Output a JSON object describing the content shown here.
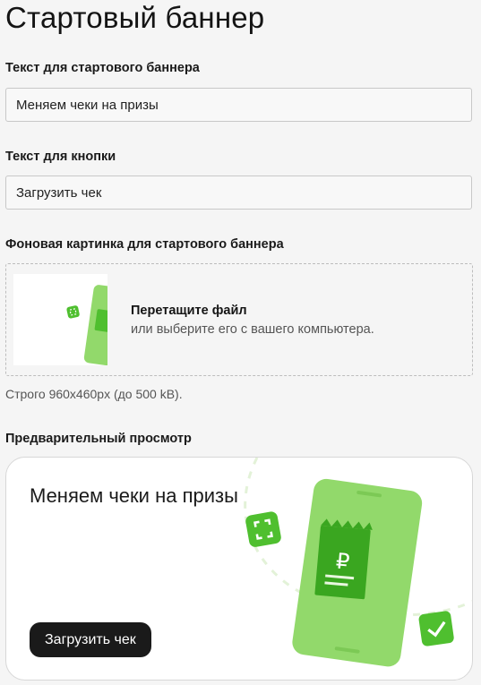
{
  "page": {
    "title": "Стартовый баннер"
  },
  "banner_text": {
    "label": "Текст для стартового баннера",
    "value": "Меняем чеки на призы"
  },
  "button_text": {
    "label": "Текст для кнопки",
    "value": "Загрузить чек"
  },
  "background_image": {
    "label": "Фоновая картинка для стартового баннера",
    "dropzone_title": "Перетащите файл",
    "dropzone_subtitle": "или выберите его с вашего компьютера.",
    "hint": "Строго 960x460px (до 500 kB)."
  },
  "preview": {
    "label": "Предварительный просмотр",
    "banner_text": "Меняем чеки на призы",
    "button_label": "Загрузить чек",
    "currency_symbol": "₽"
  },
  "colors": {
    "phone_green": "#92d96b",
    "icon_green": "#4fbf2f",
    "dark_green": "#3aa620",
    "button_dark": "#1a1a1a"
  },
  "icons": {
    "scan": "scan-frame-icon",
    "check": "checkmark-icon",
    "receipt": "receipt-ruble-icon",
    "phone": "phone-illustration"
  }
}
